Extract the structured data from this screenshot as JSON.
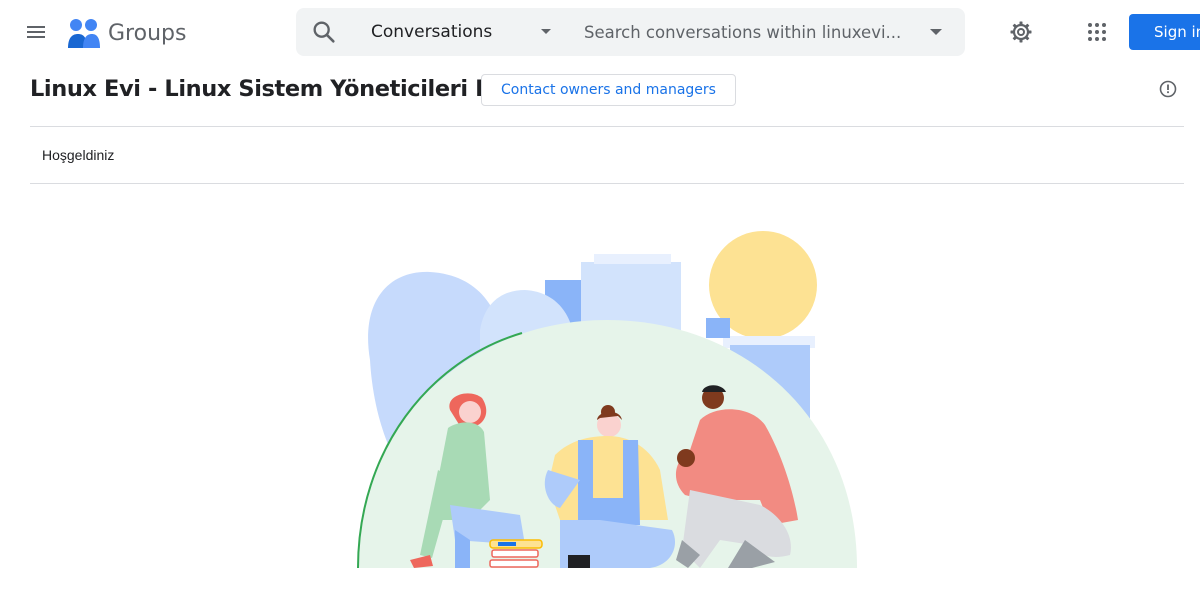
{
  "header": {
    "app_name": "Groups",
    "search": {
      "scope": "Conversations",
      "placeholder": "Search conversations within linuxevi..."
    },
    "signin_label": "Sign in"
  },
  "group": {
    "title": "Linux Evi - Linux Sistem Yöneticileri Derneği",
    "contact_label": "Contact owners and managers"
  },
  "welcome_text": "Hoşgeldiniz",
  "icons": {
    "menu": "menu-icon",
    "logo": "groups-logo-icon",
    "search": "search-icon",
    "scope_caret": "caret-down-icon",
    "options_caret": "caret-down-icon",
    "settings": "gear-icon",
    "apps": "apps-grid-icon",
    "info": "info-icon"
  },
  "colors": {
    "accent": "#1a73e8",
    "search_bg": "#f1f3f4",
    "divider": "#dadce0",
    "icon_gray": "#5f6368"
  }
}
